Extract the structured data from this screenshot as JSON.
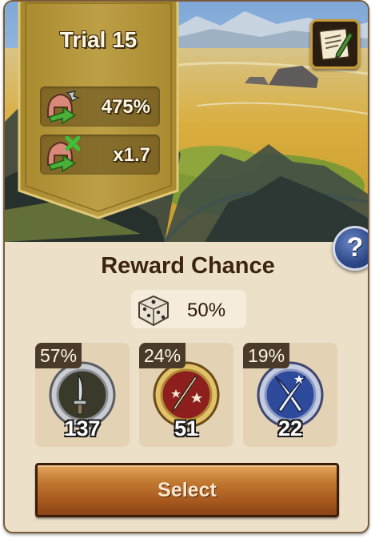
{
  "trial": {
    "title": "Trial 15",
    "stats": [
      {
        "icon": "helmet-wrench-icon",
        "value": "475%"
      },
      {
        "icon": "helmet-cross-icon",
        "value": "x1.7"
      }
    ]
  },
  "reward": {
    "title": "Reward Chance",
    "chance": {
      "icon": "dice-icon",
      "value": "50%"
    },
    "items": [
      {
        "icon": "silver-dagger-medal-icon",
        "percent": "57%",
        "count": "137"
      },
      {
        "icon": "red-star-sword-medal-icon",
        "percent": "24%",
        "count": "51"
      },
      {
        "icon": "blue-crossed-swords-medal-icon",
        "percent": "19%",
        "count": "22"
      }
    ]
  },
  "buttons": {
    "select": "Select",
    "help": "?"
  },
  "icons": {
    "notes": "notes-icon"
  },
  "colors": {
    "banner_gold": "#b5963a",
    "panel_bg": "#ede0c8",
    "button_orange": "#c0772f",
    "title_brown": "#3c2410"
  }
}
